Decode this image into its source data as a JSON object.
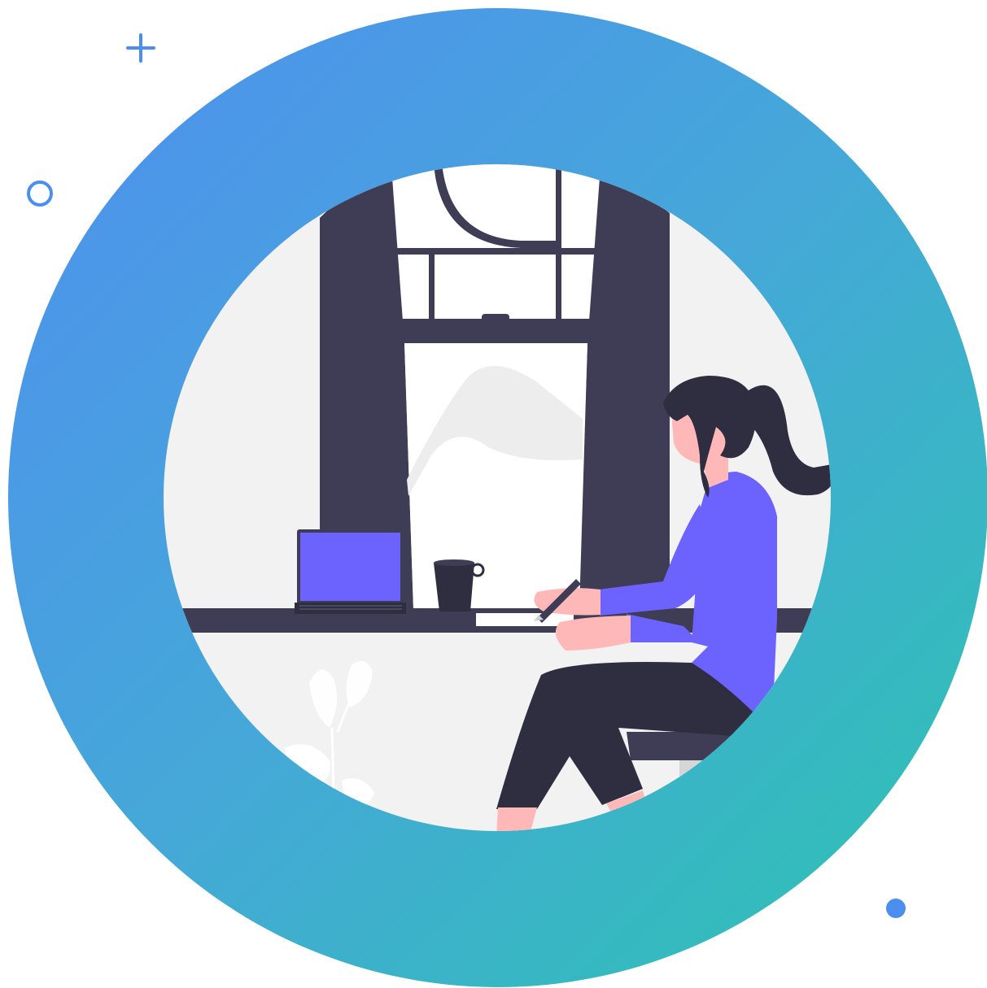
{
  "scene": {
    "description_icons": [
      "plus-icon",
      "ring-icon",
      "dot-icon"
    ],
    "colors": {
      "background": "#ffffff",
      "ring_gradient_start": "#4f92ef",
      "ring_gradient_end": "#2ebfb4",
      "accent_blue": "#4a8ff0",
      "inner_bg": "#f2f2f2",
      "curtain": "#3f3d56",
      "dark": "#2f2e41",
      "purple": "#6c63ff",
      "skin": "#ffb8b8",
      "window_glass": "#ffffff",
      "hill": "#ececec"
    }
  }
}
